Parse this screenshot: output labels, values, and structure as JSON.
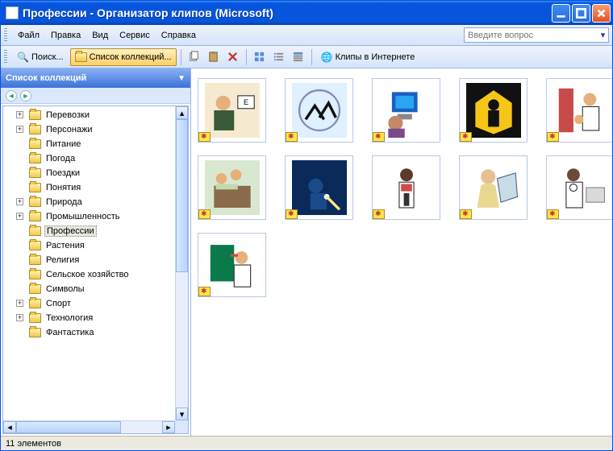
{
  "title": "Профессии - Организатор клипов (Microsoft)",
  "menu": {
    "file": "Файл",
    "edit": "Правка",
    "view": "Вид",
    "tools": "Сервис",
    "help": "Справка"
  },
  "helpbox_placeholder": "Введите вопрос",
  "toolbar": {
    "search": "Поиск...",
    "collections": "Список коллекций...",
    "clips_online": "Клипы в Интернете"
  },
  "sidebar": {
    "title": "Список коллекций",
    "items": [
      {
        "label": "Перевозки",
        "expand": "+"
      },
      {
        "label": "Персонажи",
        "expand": "+"
      },
      {
        "label": "Питание",
        "expand": ""
      },
      {
        "label": "Погода",
        "expand": ""
      },
      {
        "label": "Поездки",
        "expand": ""
      },
      {
        "label": "Понятия",
        "expand": ""
      },
      {
        "label": "Природа",
        "expand": "+"
      },
      {
        "label": "Промышленность",
        "expand": "+"
      },
      {
        "label": "Профессии",
        "expand": "",
        "selected": true
      },
      {
        "label": "Растения",
        "expand": ""
      },
      {
        "label": "Религия",
        "expand": ""
      },
      {
        "label": "Сельское хозяйство",
        "expand": ""
      },
      {
        "label": "Символы",
        "expand": ""
      },
      {
        "label": "Спорт",
        "expand": "+"
      },
      {
        "label": "Технология",
        "expand": "+"
      },
      {
        "label": "Фантастика",
        "expand": ""
      }
    ]
  },
  "clips": [
    {
      "name": "clip-1"
    },
    {
      "name": "clip-2"
    },
    {
      "name": "clip-3"
    },
    {
      "name": "clip-4"
    },
    {
      "name": "clip-5"
    },
    {
      "name": "clip-6"
    },
    {
      "name": "clip-7"
    },
    {
      "name": "clip-8"
    },
    {
      "name": "clip-9"
    },
    {
      "name": "clip-10"
    },
    {
      "name": "clip-11"
    }
  ],
  "status": "11 элементов"
}
